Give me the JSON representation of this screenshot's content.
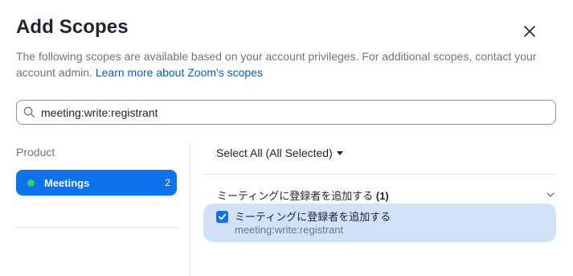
{
  "dialog": {
    "title": "Add Scopes",
    "description": "The following scopes are available based on your account privileges. For additional scopes, contact your account admin.",
    "learn_more_link": "Learn more about Zoom's scopes",
    "close_icon": "close-icon"
  },
  "search": {
    "value": "meeting:write:registrant",
    "icon": "search-icon"
  },
  "products": {
    "label": "Product",
    "items": [
      {
        "label": "Meetings",
        "count": "2",
        "status_color": "#2bd266",
        "selected": true
      }
    ]
  },
  "scopes": {
    "select_all_label": "Select All (All Selected)",
    "groups": [
      {
        "name": "ミーティングに登録者を追加する",
        "count": "(1)",
        "expanded": true,
        "items": [
          {
            "name": "ミーティングに登録者を追加する",
            "id": "meeting:write:registrant",
            "checked": true
          }
        ]
      }
    ]
  },
  "colors": {
    "accent": "#0e72ed",
    "link": "#0e5fb8",
    "selected_row_bg": "#d0e1f8",
    "status_dot": "#2bd266"
  }
}
